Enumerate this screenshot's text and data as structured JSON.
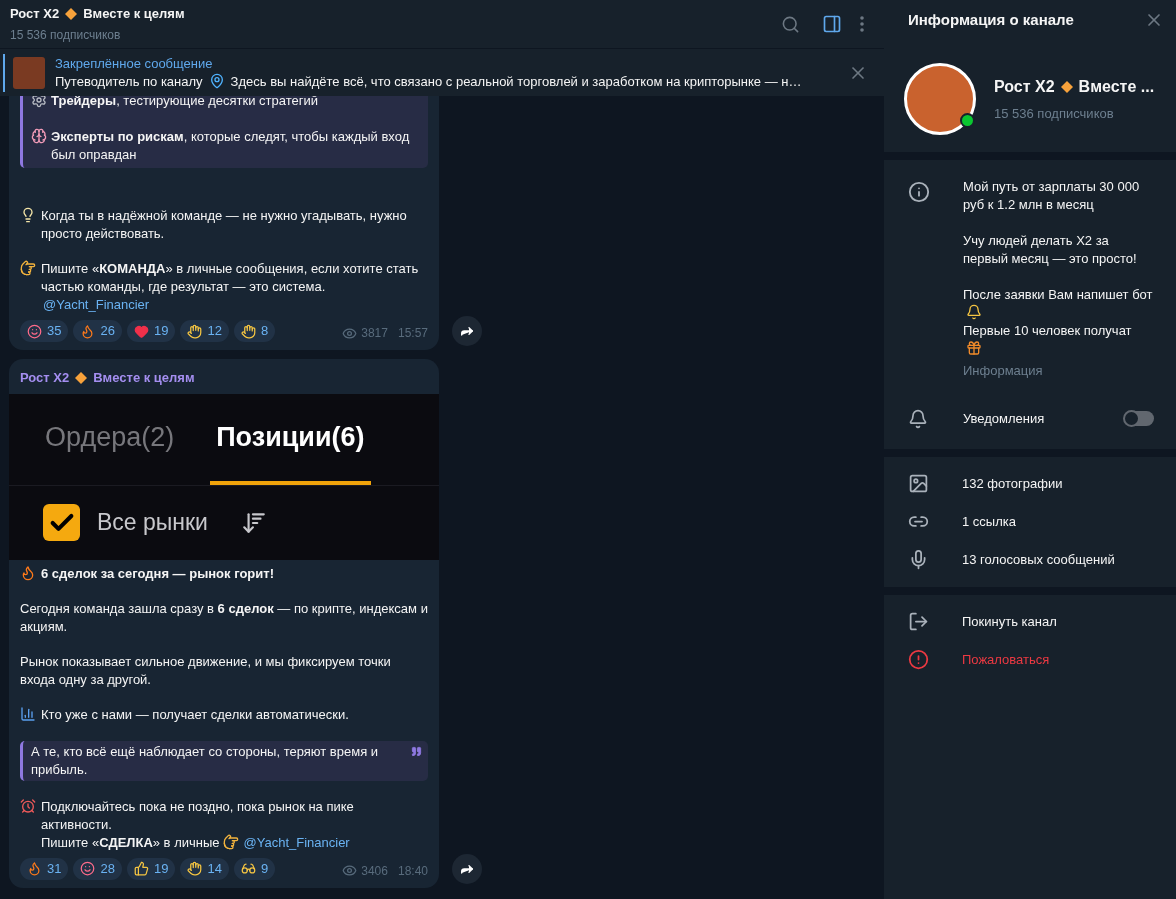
{
  "header": {
    "title": [
      "Рост X2",
      "Вместе к целям"
    ],
    "subtitle": "15 536 подписчиков",
    "sidebar_toggle_active": true
  },
  "pinned": {
    "title": "Закреплённое сообщение",
    "text_before": "Путеводитель по каналу",
    "text_after": "Здесь вы найдёте всё, что связано с реальной торговлей и заработком на крипторынке — н…"
  },
  "messages": [
    {
      "quote": [
        {
          "kind": "gear",
          "text": "**Трейдеры**, тестирующие десятки стратегий"
        },
        {
          "kind": "brain",
          "text": "**Эксперты по рискам**, которые следят, чтобы каждый вход был оправдан"
        }
      ],
      "paragraphs": [
        {
          "kind": "text",
          "parts": [
            {
              "kind": "bulb"
            },
            {
              "kind": "text",
              "text": "Когда ты в надёжной команде — не нужно угадывать, нужно просто действовать."
            }
          ]
        },
        {
          "kind": "text",
          "parts": [
            {
              "kind": "point"
            },
            {
              "kind": "text",
              "text": "Пишите «**КОМАНДА**» в личные сообщения, если хотите стать частью команды, где результат — это система."
            },
            {
              "kind": "break"
            },
            {
              "kind": "link",
              "text": "@Yacht_Financier"
            }
          ]
        }
      ],
      "reactions": [
        {
          "kind": "hot-face",
          "count": "35"
        },
        {
          "kind": "fire",
          "count": "26"
        },
        {
          "kind": "heart",
          "count": "19"
        },
        {
          "kind": "clap",
          "count": "12"
        },
        {
          "kind": "ok-hand",
          "count": "8"
        }
      ],
      "views": "3817",
      "time": "15:57"
    },
    {
      "author": [
        "Рост X2",
        "Вместе к целям"
      ],
      "screenshot": {
        "tabs": [
          {
            "label": "Ордера(2)",
            "selected": false
          },
          {
            "label": "Позиции(6)",
            "selected": true
          }
        ],
        "filter": {
          "label": "Все рынки",
          "checked": true
        }
      },
      "paragraphs": [
        {
          "kind": "text",
          "parts": [
            {
              "kind": "fire"
            },
            {
              "kind": "text",
              "text": "6 сделок за сегодня — рынок горит!",
              "bold": true
            }
          ]
        },
        {
          "kind": "text",
          "parts": [
            {
              "kind": "text",
              "text": "Сегодня команда зашла сразу в **6 сделок** — по крипте, индексам и акциям."
            }
          ]
        },
        {
          "kind": "text",
          "parts": [
            {
              "kind": "text",
              "text": "Рынок показывает сильное движение, и мы фиксируем точки входа одну за другой."
            }
          ]
        },
        {
          "kind": "text",
          "parts": [
            {
              "kind": "chart"
            },
            {
              "kind": "text",
              "text": "Кто уже с нами — получает сделки автоматически."
            }
          ]
        },
        {
          "kind": "quote",
          "parts": [
            {
              "kind": "text",
              "text": "А те, кто всё ещё наблюдает со стороны, теряют время и прибыль."
            }
          ]
        },
        {
          "kind": "text",
          "parts": [
            {
              "kind": "alarm"
            },
            {
              "kind": "text",
              "text": "Подключайтесь пока не поздно, пока рынок на пике активности."
            },
            {
              "kind": "break"
            },
            {
              "kind": "text",
              "text": "Пишите «**СДЕЛКА**» в личные"
            },
            {
              "kind": "point"
            },
            {
              "kind": "link",
              "text": "@Yacht_Financier"
            }
          ]
        }
      ],
      "reactions": [
        {
          "kind": "fire",
          "count": "31"
        },
        {
          "kind": "hot-face",
          "count": "28"
        },
        {
          "kind": "thumbs-up",
          "count": "19"
        },
        {
          "kind": "clap",
          "count": "14"
        },
        {
          "kind": "cool",
          "count": "9"
        }
      ],
      "views": "3406",
      "time": "18:40"
    }
  ],
  "panel": {
    "title": "Информация о канале",
    "name": [
      "Рост X2",
      "Вместе ..."
    ],
    "subscribers": "15 536 подписчиков",
    "online": true,
    "description": [
      {
        "kind": "text",
        "text": "Мой путь от зарплаты 30 000 руб к 1.2 млн в месяц"
      },
      {
        "kind": "gap"
      },
      {
        "kind": "text",
        "text": "Учу людей делать X2 за первый месяц — это просто!"
      },
      {
        "kind": "gap"
      },
      {
        "kind": "text",
        "text": "После заявки Вам напишет бот"
      },
      {
        "kind": "bell"
      },
      {
        "kind": "break"
      },
      {
        "kind": "text",
        "text": "Первые 10 человек получат"
      },
      {
        "kind": "gift"
      }
    ],
    "description_label": "Информация",
    "notifications": {
      "label": "Уведомления",
      "on": false
    },
    "media": [
      {
        "kind": "photos",
        "label": "132 фотографии"
      },
      {
        "kind": "links",
        "label": "1 ссылка"
      },
      {
        "kind": "voice",
        "label": "13 голосовых сообщений"
      }
    ],
    "actions": [
      {
        "kind": "leave",
        "label": "Покинуть канал"
      },
      {
        "kind": "report",
        "label": "Пожаловаться"
      }
    ]
  }
}
